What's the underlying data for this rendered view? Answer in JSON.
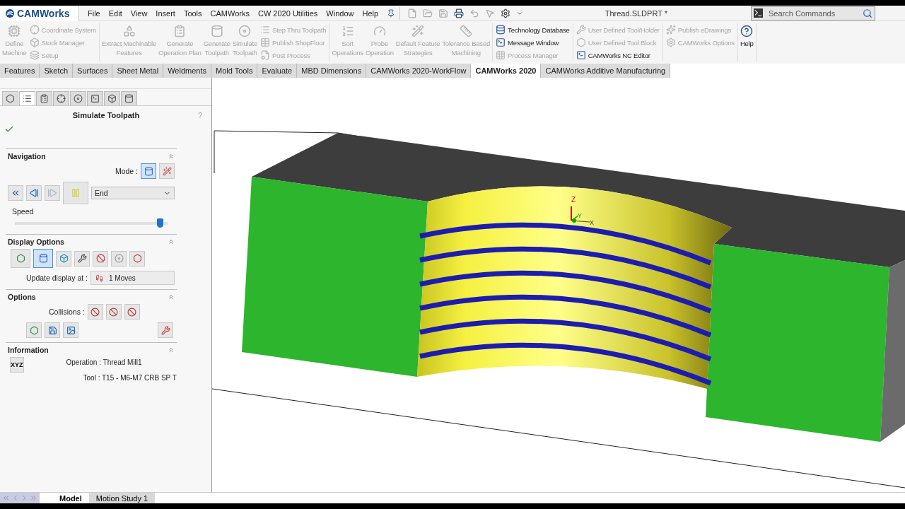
{
  "app": {
    "logo": "CAMWorks"
  },
  "menu": [
    "File",
    "Edit",
    "View",
    "Insert",
    "Tools",
    "CAMWorks",
    "CW 2020 Utilities",
    "Window",
    "Help"
  ],
  "document_title": "Thread.SLDPRT *",
  "search": {
    "placeholder": "Search Commands"
  },
  "ribbon": [
    {
      "items": [
        {
          "kind": "large",
          "label": "Define\nMachine",
          "disabled": true
        },
        {
          "kind": "small",
          "label": "Coordinate System",
          "disabled": true
        },
        {
          "kind": "small",
          "label": "Stock Manager",
          "disabled": true
        },
        {
          "kind": "small",
          "label": "Setup",
          "disabled": true
        }
      ]
    },
    {
      "items": [
        {
          "kind": "large",
          "label": "Extract Machinable\nFeatures",
          "disabled": true
        },
        {
          "kind": "large",
          "label": "Generate\nOperation Plan",
          "disabled": true
        },
        {
          "kind": "large",
          "label": "Generate\nToolpath",
          "disabled": true
        },
        {
          "kind": "large",
          "label": "Simulate\nToolpath",
          "disabled": true
        },
        {
          "kind": "small",
          "label": "Step Thru Toolpath",
          "disabled": true
        },
        {
          "kind": "small",
          "label": "Publish ShopFloor",
          "disabled": true
        },
        {
          "kind": "small",
          "label": "Post Process",
          "disabled": true
        }
      ]
    },
    {
      "items": [
        {
          "kind": "large",
          "label": "Sort\nOperations",
          "disabled": true
        },
        {
          "kind": "large",
          "label": "Probe\nOperation",
          "disabled": true
        },
        {
          "kind": "large",
          "label": "Default Feature\nStrategies",
          "disabled": true
        },
        {
          "kind": "large",
          "label": "Tolerance Based\nMachining",
          "disabled": true
        }
      ]
    },
    {
      "items": [
        {
          "kind": "small",
          "label": "Technology Database",
          "disabled": false
        },
        {
          "kind": "small",
          "label": "Message Window",
          "disabled": false
        },
        {
          "kind": "small",
          "label": "Process Manager",
          "disabled": true
        }
      ]
    },
    {
      "items": [
        {
          "kind": "small",
          "label": "User Defined Tool/Holder",
          "disabled": true
        },
        {
          "kind": "small",
          "label": "User Defined Tool Block",
          "disabled": true
        },
        {
          "kind": "small",
          "label": "CAMWorks NC Editor",
          "disabled": false
        }
      ]
    },
    {
      "items": [
        {
          "kind": "small",
          "label": "Publish eDrawings",
          "disabled": true
        },
        {
          "kind": "small",
          "label": "CAMWorks Options",
          "disabled": true
        }
      ]
    },
    {
      "items": [
        {
          "kind": "large",
          "label": "Help",
          "disabled": false
        }
      ]
    }
  ],
  "tabs": [
    {
      "label": "Features",
      "selected": false
    },
    {
      "label": "Sketch",
      "selected": false
    },
    {
      "label": "Surfaces",
      "selected": false
    },
    {
      "label": "Sheet Metal",
      "selected": false
    },
    {
      "label": "Weldments",
      "selected": false
    },
    {
      "label": "Mold Tools",
      "selected": false
    },
    {
      "label": "Evaluate",
      "selected": false
    },
    {
      "label": "MBD Dimensions",
      "selected": false
    },
    {
      "label": "CAMWorks 2020-WorkFlow",
      "selected": false
    },
    {
      "label": "CAMWorks 2020",
      "selected": true
    },
    {
      "label": "CAMWorks Additive Manufacturing",
      "selected": false
    }
  ],
  "property_manager": {
    "panel_tabs": [
      {
        "selected": false
      },
      {
        "selected": true
      },
      {
        "selected": false
      },
      {
        "selected": false
      },
      {
        "selected": false
      },
      {
        "selected": false
      },
      {
        "selected": false
      },
      {
        "selected": false
      }
    ],
    "title": "Simulate Toolpath",
    "help": "?",
    "navigation": {
      "title": "Navigation",
      "mode_label": "Mode :",
      "modes": [
        {
          "selected": true
        },
        {
          "selected": false
        }
      ],
      "playback": [
        {
          "disabled": false
        },
        {
          "disabled": false
        },
        {
          "disabled": true
        }
      ],
      "position": "End",
      "speed_label": "Speed",
      "speed": {
        "level": 0.95
      }
    },
    "display_options": {
      "title": "Display Options",
      "toggles": [
        {
          "selected": false
        },
        {
          "selected": true
        },
        {
          "selected": false
        },
        {
          "selected": false
        },
        {
          "selected": false
        },
        {
          "selected": false
        },
        {
          "selected": false
        }
      ],
      "update_label": "Update display at :",
      "update_value": "1 Moves"
    },
    "options": {
      "title": "Options",
      "collisions_label": "Collisions :"
    },
    "information": {
      "title": "Information",
      "xyz": "XYZ",
      "operation": "Operation : Thread Mill1",
      "tool": "Tool : T15 - M6-M7 CRB SP T"
    }
  },
  "viewport": {
    "axis_labels": [
      "Z",
      "Y",
      "X"
    ]
  },
  "bottom_tabs": [
    {
      "label": "Model",
      "selected": true
    },
    {
      "label": "Motion Study 1",
      "selected": false
    }
  ]
}
